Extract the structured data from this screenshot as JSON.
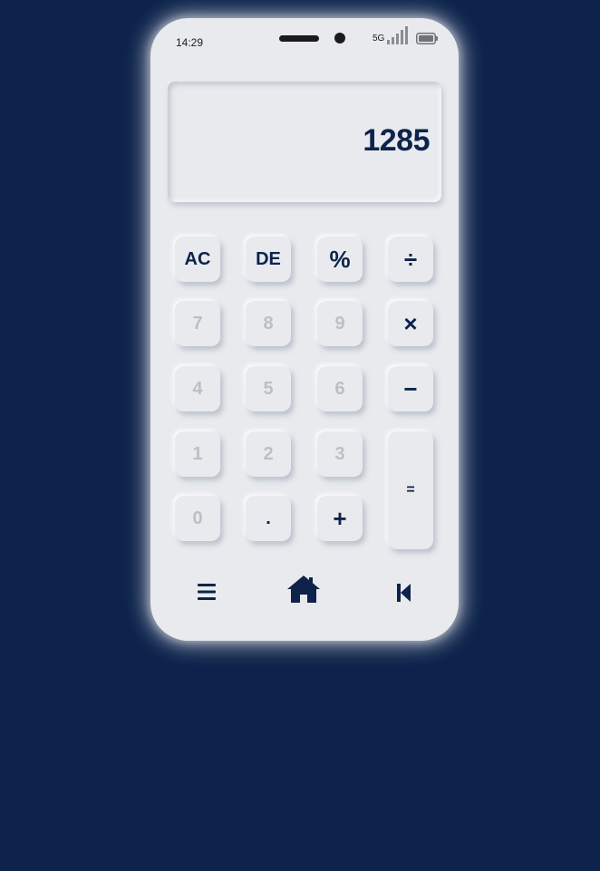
{
  "status_bar": {
    "time": "14:29",
    "network": "5G",
    "signal_icon": "signal-bars-icon",
    "battery_icon": "battery-icon"
  },
  "display": {
    "value": "1285"
  },
  "keypad": {
    "ac": "AC",
    "de": "DE",
    "percent": "%",
    "divide": "÷",
    "seven": "7",
    "eight": "8",
    "nine": "9",
    "multiply": "×",
    "four": "4",
    "five": "5",
    "six": "6",
    "minus": "−",
    "one": "1",
    "two": "2",
    "three": "3",
    "zero": "0",
    "dot": ".",
    "plus": "+",
    "equals": "="
  },
  "nav": {
    "menu_icon": "menu-icon",
    "home_icon": "home-icon",
    "back_icon": "skip-back-icon"
  },
  "colors": {
    "background": "#0d234b",
    "phone": "#e8eaed",
    "accent": "#0d234b",
    "digit": "#bcbfc4"
  }
}
